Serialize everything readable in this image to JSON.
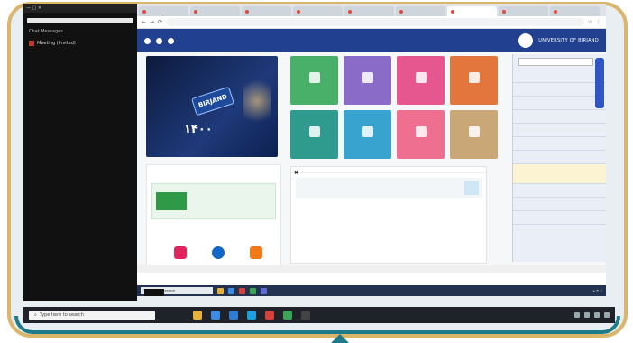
{
  "frame": {
    "border_color": "#d9b66b",
    "accent_color": "#1d7b8a"
  },
  "meeting_panel": {
    "search_placeholder": "",
    "header": "Chat Messages",
    "item": "Meeting (Invited)"
  },
  "browser": {
    "tabs": [
      "",
      "",
      "",
      "",
      "",
      "",
      "",
      "",
      ""
    ],
    "url": "",
    "site_header": {
      "university_name": "UNIVERSITY OF BIRJAND",
      "title_line1": "",
      "title_line2": "",
      "links": [
        "",
        ""
      ]
    },
    "sidebar": {
      "items": [
        "",
        "",
        "",
        "",
        "",
        "",
        "",
        "",
        "",
        "",
        ""
      ]
    },
    "banner": {
      "sign": "BIRJAND",
      "number": "۱۴۰۰",
      "subtitle": ""
    },
    "tiles": [
      {
        "label": "",
        "color": "#e2763c"
      },
      {
        "label": "",
        "color": "#e6568f"
      },
      {
        "label": "",
        "color": "#8a6cc8"
      },
      {
        "label": "",
        "color": "#49b06a"
      },
      {
        "label": "",
        "color": "#c9a777"
      },
      {
        "label": "",
        "color": "#ee6f8f"
      },
      {
        "label": "",
        "color": "#39a3cf"
      },
      {
        "label": "",
        "color": "#2f9a8e"
      }
    ],
    "news": {
      "title": "",
      "text": "",
      "badge": ""
    },
    "usage": {
      "title": "",
      "subtitle": "",
      "button": "",
      "text": ""
    },
    "status_text": ""
  },
  "inner_taskbar": {
    "search_placeholder": "Type here to search"
  },
  "tooltip": "",
  "outer_taskbar": {
    "search_placeholder": "Type here to search"
  }
}
